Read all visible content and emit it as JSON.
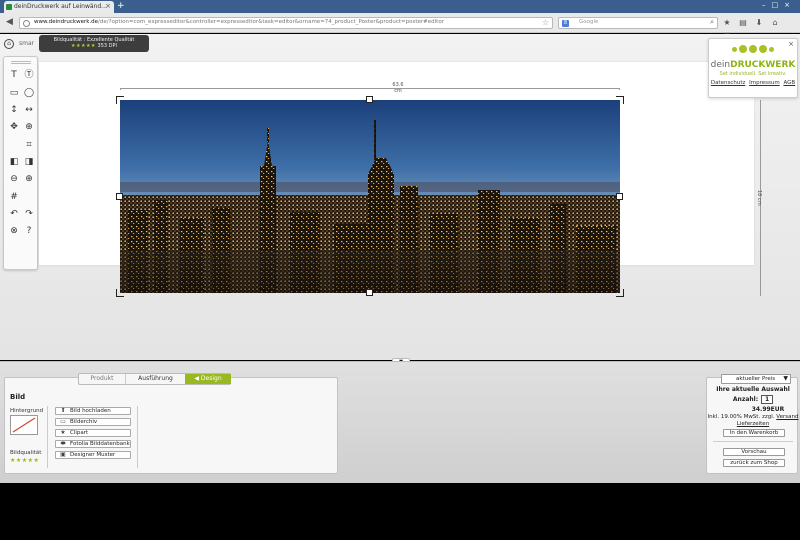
{
  "browser": {
    "tab_title": "deinDruckwerk auf Leinwänd...",
    "url_domain": "www.deindruckwerk.de",
    "url_path": "/de/?option=com_expresseditor&controller=expresseditor&task=editor&orname=74_product_Poster&product=poster#editor",
    "search_placeholder": "Google",
    "search_engine_letter": "8"
  },
  "editor": {
    "smart_label": "smar",
    "quality_tooltip": {
      "line1": "Bildqualität : Exzellente Qualität",
      "stars": "★★★★★",
      "dpi": "353 DPI"
    },
    "width_label": "63.6 cm",
    "height_label": "18 cm"
  },
  "logo": {
    "brand_prefix": "dein",
    "brand_main": "DRUCKWERK",
    "slogan": "Set individuell. Set kreativ.",
    "links": [
      "Datenschutz",
      "Impressum",
      "AGB"
    ]
  },
  "panel": {
    "tabs": [
      "Produkt",
      "Ausführung",
      "Design"
    ],
    "active_tab_marker": "◀",
    "title": "Bild",
    "background_label": "Hintergrund",
    "quality_label": "Bildqualität",
    "quality_stars": "★★★★★",
    "actions": [
      {
        "icon": "⬆",
        "label": "Bild hochladen"
      },
      {
        "icon": "▭",
        "label": "Bilderchiv"
      },
      {
        "icon": "★",
        "label": "Clipart"
      },
      {
        "icon": "⬬",
        "label": "Fotolia Bilddatenbank"
      },
      {
        "icon": "▣",
        "label": "Designer Muster"
      }
    ]
  },
  "price": {
    "select_value": "aktueller Preis",
    "heading": "Ihre aktuelle Auswahl",
    "qty_label": "Anzahl:",
    "qty_value": "1",
    "amount": "34.99EUR",
    "tax_text": "Inkl. 19.00% MwSt. zzgl.",
    "shipping_link": "Versand",
    "delivery_link": "Lieferzeiten",
    "cart_button": "In den Warenkorb",
    "preview_button": "Vorschau",
    "back_button": "zurück zum Shop"
  },
  "colors": {
    "accent": "#9ab81f",
    "browser_frame": "#3a5f8e"
  }
}
